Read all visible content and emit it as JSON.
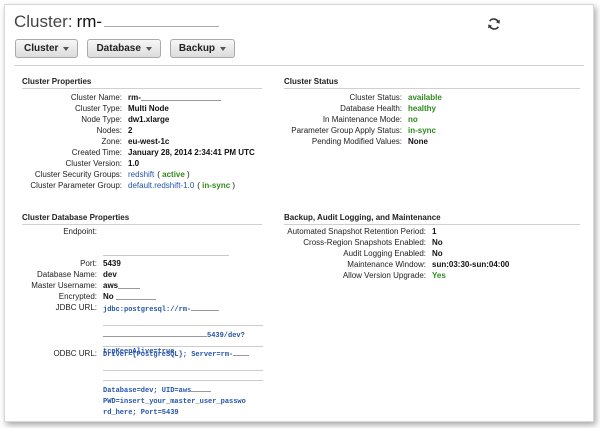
{
  "header": {
    "title_label": "Cluster:",
    "title_name": "rm-"
  },
  "toolbar": {
    "cluster_label": "Cluster",
    "database_label": "Database",
    "backup_label": "Backup"
  },
  "cluster_properties": {
    "title": "Cluster Properties",
    "rows": [
      {
        "k": "Cluster Name:",
        "v": "rm-"
      },
      {
        "k": "Cluster Type:",
        "v": "Multi Node"
      },
      {
        "k": "Node Type:",
        "v": "dw1.xlarge"
      },
      {
        "k": "Nodes:",
        "v": "2"
      },
      {
        "k": "Zone:",
        "v": "eu-west-1c"
      },
      {
        "k": "Created Time:",
        "v": "January 28, 2014 2:34:41 PM UTC"
      },
      {
        "k": "Cluster Version:",
        "v": "1.0"
      },
      {
        "k": "Cluster Security Groups:",
        "v": "redshift",
        "status": "active"
      },
      {
        "k": "Cluster Parameter Group:",
        "v": "default.redshift-1.0",
        "status": "in-sync"
      }
    ]
  },
  "cluster_status": {
    "title": "Cluster Status",
    "rows": [
      {
        "k": "Cluster Status:",
        "v": "available"
      },
      {
        "k": "Database Health:",
        "v": "healthy"
      },
      {
        "k": "In Maintenance Mode:",
        "v": "no"
      },
      {
        "k": "Parameter Group Apply Status:",
        "v": "in-sync"
      },
      {
        "k": "Pending Modified Values:",
        "v": "None"
      }
    ]
  },
  "db_properties": {
    "title": "Cluster Database Properties",
    "endpoint_label": "Endpoint:",
    "port_label": "Port:",
    "port": "5439",
    "dbname_label": "Database Name:",
    "dbname": "dev",
    "master_label": "Master Username:",
    "master": "aws",
    "encrypted_label": "Encrypted:",
    "encrypted": "No",
    "jdbc_label": "JDBC URL:",
    "jdbc_1": "jdbc:postgresql://rm-",
    "jdbc_2": "5439/dev?",
    "jdbc_3": "tcpKeepAlive=true",
    "odbc_label": "ODBC URL:",
    "odbc_1": "Driver={PostgreSQL}; Server=rm-",
    "odbc_2": "Database=dev; UID=aws",
    "odbc_3": "PWD=insert_your_master_user_passwo",
    "odbc_4": "rd_here; Port=5439"
  },
  "backup": {
    "title": "Backup, Audit Logging, and Maintenance",
    "rows": [
      {
        "k": "Automated Snapshot Retention Period:",
        "v": "1"
      },
      {
        "k": "Cross-Region Snapshots Enabled:",
        "v": "No"
      },
      {
        "k": "Audit Logging Enabled:",
        "v": "No"
      },
      {
        "k": "Maintenance Window:",
        "v": "sun:03:30-sun:04:00"
      },
      {
        "k": "Allow Version Upgrade:",
        "v": "Yes"
      }
    ]
  },
  "colors": {
    "green": "#2e8b1e",
    "blue": "#2454a8"
  }
}
